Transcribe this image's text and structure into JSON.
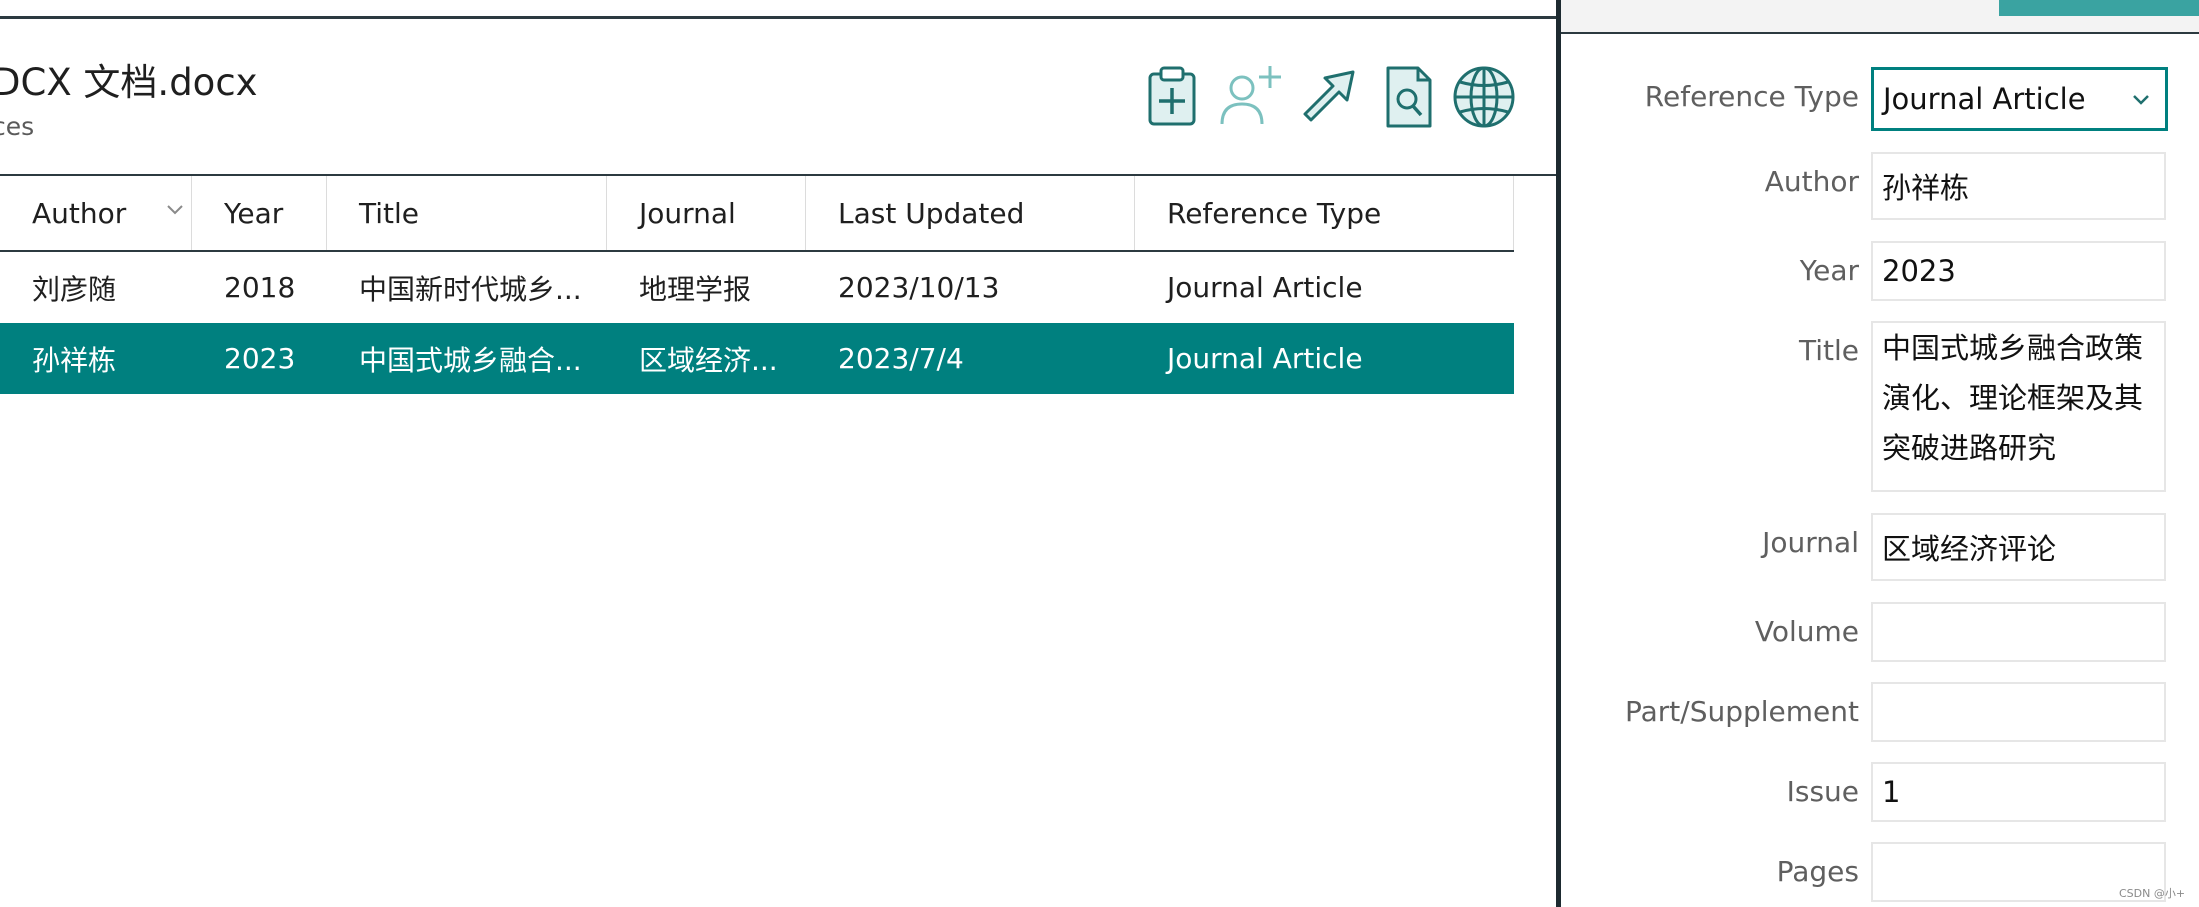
{
  "document": {
    "title": "DCX 文档.docx",
    "subtitle": "ces"
  },
  "toolbar": {
    "icons": [
      "clipboard-plus-icon",
      "add-author-icon",
      "arrow-up-right-icon",
      "find-document-icon",
      "globe-icon"
    ]
  },
  "table": {
    "headers": {
      "author": "Author",
      "year": "Year",
      "title": "Title",
      "journal": "Journal",
      "last_updated": "Last Updated",
      "reference_type": "Reference Type"
    },
    "rows": [
      {
        "author": "刘彦随",
        "year": "2018",
        "title": "中国新时代城乡...",
        "journal": "地理学报",
        "last_updated": "2023/10/13",
        "reference_type": "Journal Article",
        "selected": false
      },
      {
        "author": "孙祥栋",
        "year": "2023",
        "title": "中国式城乡融合...",
        "journal": "区域经济...",
        "last_updated": "2023/7/4",
        "reference_type": "Journal Article",
        "selected": true
      }
    ]
  },
  "details": {
    "reference_type": {
      "label": "Reference Type",
      "value": "Journal Article"
    },
    "author": {
      "label": "Author",
      "value": "孙祥栋"
    },
    "year": {
      "label": "Year",
      "value": "2023"
    },
    "title": {
      "label": "Title",
      "lines": [
        "中国式城乡融合政策",
        "演化、理论框架及其",
        "突破进路研究"
      ]
    },
    "journal": {
      "label": "Journal",
      "value": "区域经济评论"
    },
    "volume": {
      "label": "Volume",
      "value": ""
    },
    "part_supplement": {
      "label": "Part/Supplement",
      "value": ""
    },
    "issue": {
      "label": "Issue",
      "value": "1"
    },
    "pages": {
      "label": "Pages",
      "value": ""
    }
  },
  "watermark": "CSDN @小+",
  "colors": {
    "accent": "#00807f",
    "accent_light": "#3aa3a1",
    "dark_rule": "#2c3a40",
    "label_gray": "#5f5f5f"
  }
}
